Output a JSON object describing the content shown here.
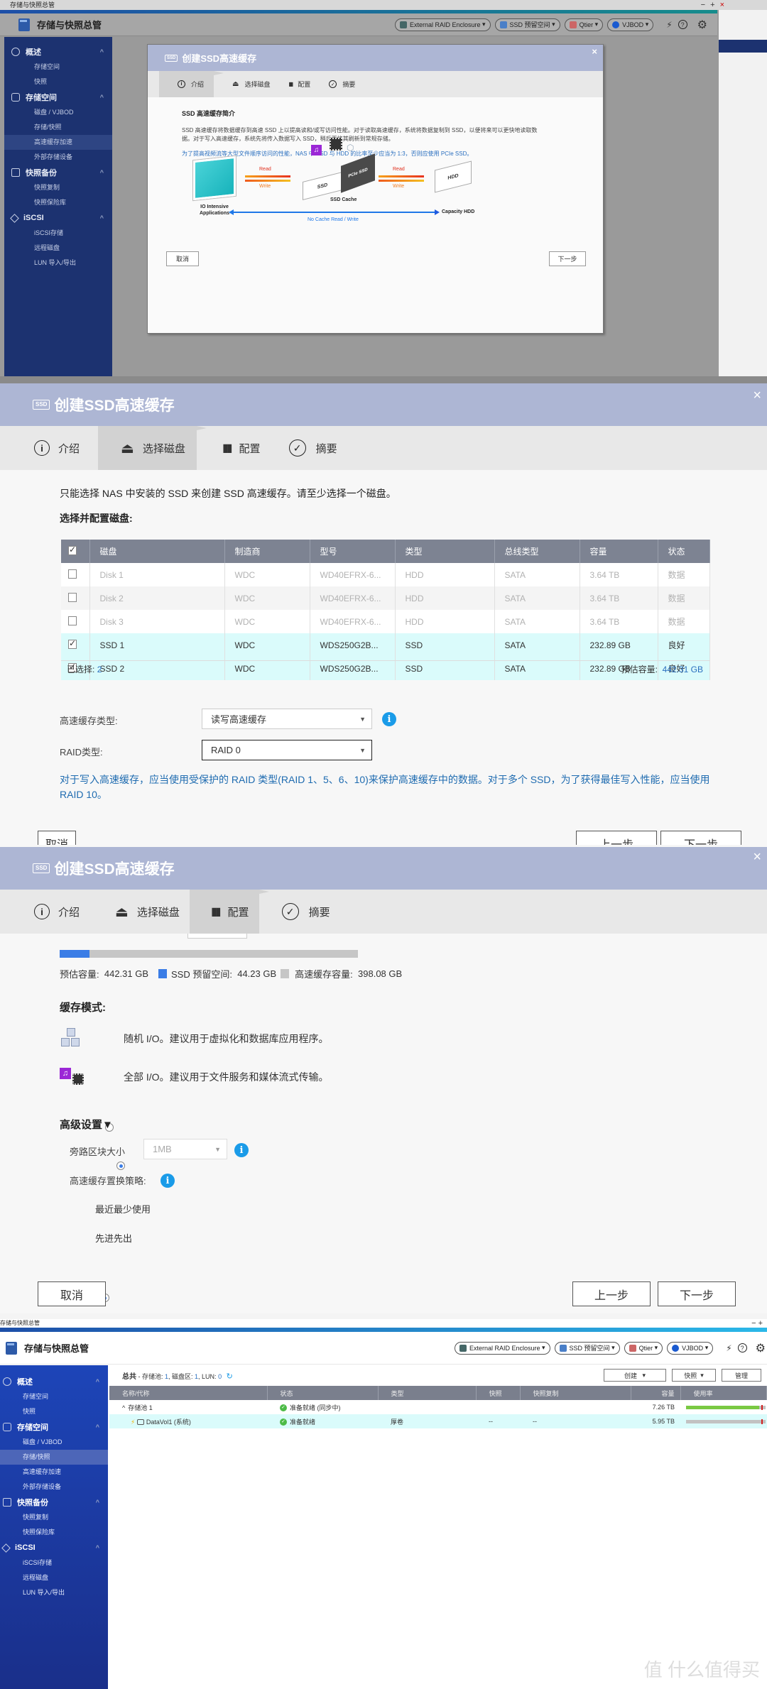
{
  "app": {
    "window_title": "存储与快照总管",
    "title": "存储与快照总管",
    "window_controls": {
      "minimize": "−",
      "maximize": "+",
      "close": "×"
    },
    "toolbar": [
      {
        "label": "External RAID Enclosure",
        "icon": "raid-enclosure-icon"
      },
      {
        "label": "SSD 预留空间",
        "icon": "ssd-overprovision-icon"
      },
      {
        "label": "Qtier",
        "icon": "qtier-icon"
      },
      {
        "label": "VJBOD",
        "icon": "vjbod-icon"
      }
    ],
    "toolbar_dropdown_glyph": "▾",
    "right_icons": {
      "magic": "⚡",
      "help": "?",
      "settings": "⚙"
    }
  },
  "sidebar": {
    "sections": [
      {
        "label": "概述",
        "icon": "gauge-icon",
        "items": [
          "存储空间",
          "快照"
        ]
      },
      {
        "label": "存储空间",
        "icon": "database-icon",
        "items": [
          "磁盘 / VJBOD",
          "存储/快照",
          "高速缓存加速",
          "外部存储设备"
        ]
      },
      {
        "label": "快照备份",
        "icon": "snapshot-icon",
        "items": [
          "快照复制",
          "快照保险库"
        ]
      },
      {
        "label": "iSCSI",
        "icon": "iscsi-icon",
        "items": [
          "iSCSI存储",
          "远程磁盘",
          "LUN 导入/导出"
        ]
      }
    ],
    "collapse_glyph": "^"
  },
  "wizard": {
    "title": "创建SSD高速缓存",
    "ssd_badge": "SSD",
    "close": "×",
    "steps": [
      {
        "label": "介绍",
        "icon": "info-circle-icon",
        "glyph": "i"
      },
      {
        "label": "选择磁盘",
        "icon": "disk-drive-icon",
        "glyph": "⏏"
      },
      {
        "label": "配置",
        "icon": "config-icon",
        "glyph": "▮▮"
      },
      {
        "label": "摘要",
        "icon": "check-circle-icon",
        "glyph": "✓"
      }
    ],
    "cancel": "取消",
    "previous": "上一步",
    "next": "下一步"
  },
  "intro": {
    "heading": "SSD 高速缓存简介",
    "body": "SSD 高速缓存将数据缓存到高速 SSD 上以提高读和/或写访问性能。对于读取高速缓存，系统将数据复制到 SSD，以便将来可以更快地读取数据。对于写入高速缓存，系统先将传入数据写入 SSD，稍后再将其刷新到常规存储。",
    "note": "为了提高视频流等大型文件顺序访问的性能，NAS 中 SSD 与 HDD 的比率至少应当为 1:3，否则应使用 PCIe SSD。",
    "diagram": {
      "app_label_1": "IO Intensive",
      "app_label_2": "Applications",
      "read": "Read",
      "write": "Write",
      "ssd": "SSD",
      "pcie": "PCIe SSD",
      "cache_label": "SSD Cache",
      "hdd": "HDD",
      "hdd_label": "Capacity HDD",
      "nocache": "No Cache Read / Write"
    }
  },
  "select_disks": {
    "hint": "只能选择 NAS 中安装的 SSD 来创建 SSD 高速缓存。请至少选择一个磁盘。",
    "section_title": "选择并配置磁盘:",
    "columns": [
      "磁盘",
      "制造商",
      "型号",
      "类型",
      "总线类型",
      "容量",
      "状态"
    ],
    "rows": [
      {
        "checked": false,
        "enabled": false,
        "cells": [
          "Disk 1",
          "WDC",
          "WD40EFRX-6...",
          "HDD",
          "SATA",
          "3.64 TB",
          "数据"
        ]
      },
      {
        "checked": false,
        "enabled": false,
        "cells": [
          "Disk 2",
          "WDC",
          "WD40EFRX-6...",
          "HDD",
          "SATA",
          "3.64 TB",
          "数据"
        ]
      },
      {
        "checked": false,
        "enabled": false,
        "cells": [
          "Disk 3",
          "WDC",
          "WD40EFRX-6...",
          "HDD",
          "SATA",
          "3.64 TB",
          "数据"
        ]
      },
      {
        "checked": true,
        "enabled": true,
        "cells": [
          "SSD 1",
          "WDC",
          "WDS250G2B...",
          "SSD",
          "SATA",
          "232.89 GB",
          "良好"
        ]
      },
      {
        "checked": true,
        "enabled": true,
        "cells": [
          "SSD 2",
          "WDC",
          "WDS250G2B...",
          "SSD",
          "SATA",
          "232.89 GB",
          "良好"
        ]
      }
    ],
    "selected_label": "已选择:",
    "selected_count": "2",
    "est_label": "预估容量:",
    "est_value": "442.31 GB",
    "cache_type_label": "高速缓存类型:",
    "cache_type_value": "读写高速缓存",
    "raid_label": "RAID类型:",
    "raid_value": "RAID 0",
    "raid_note": "对于写入高速缓存，应当使用受保护的 RAID 类型(RAID 1、5、6、10)来保护高速缓存中的数据。对于多个 SSD，为了获得最佳写入性能，应当使用 RAID 10。"
  },
  "config": {
    "usage_fraction_reserved": 0.1,
    "est_label": "预估容量:",
    "est_value": "442.31 GB",
    "reserved_label": "SSD 预留空间:",
    "reserved_value": "44.23 GB",
    "cache_cap_label": "高速缓存容量:",
    "cache_cap_value": "398.08 GB",
    "colors": {
      "reserved": "#3b7de6",
      "cache": "#c6c6c6"
    },
    "mode_title": "缓存模式:",
    "modes": [
      {
        "label": "随机 I/O。建议用于虚拟化和数据库应用程序。",
        "selected": false
      },
      {
        "label": "全部 I/O。建议用于文件服务和媒体流式传输。",
        "selected": true
      }
    ],
    "advanced_title": "高级设置▼",
    "bypass_label": "旁路区块大小",
    "bypass_value": "1MB",
    "policy_label": "高速缓存置换策略:",
    "policies": [
      {
        "label": "最近最少使用",
        "selected": true
      },
      {
        "label": "先进先出",
        "selected": false
      }
    ]
  },
  "overview": {
    "summary_title": "总共",
    "summary_prefix": " - 存储池: ",
    "pools": "1",
    "volumes_label": ", 磁盘区: ",
    "volumes": "1",
    "luns_label": ", LUN: ",
    "luns": "0",
    "buttons": {
      "create": "创建",
      "snapshot": "快照",
      "manage": "管理"
    },
    "columns": [
      "名称/代称",
      "状态",
      "类型",
      "快照",
      "快照复制",
      "容量",
      "使用率"
    ],
    "rows": [
      {
        "name": "存储池 1",
        "expand": "^",
        "status": "准备就绪 (同步中)",
        "type": "",
        "snapshot": "",
        "replica": "",
        "capacity": "7.26 TB",
        "usage": 0.92
      },
      {
        "name": "DataVol1 (系统)",
        "status": "准备就绪",
        "type": "厚卷",
        "snapshot": "--",
        "replica": "--",
        "capacity": "5.95 TB",
        "usage": 0.0
      }
    ],
    "colors": {
      "usage": "#7ac943",
      "threshold": "#d21f1f"
    }
  },
  "watermark": "值 什么值得买"
}
